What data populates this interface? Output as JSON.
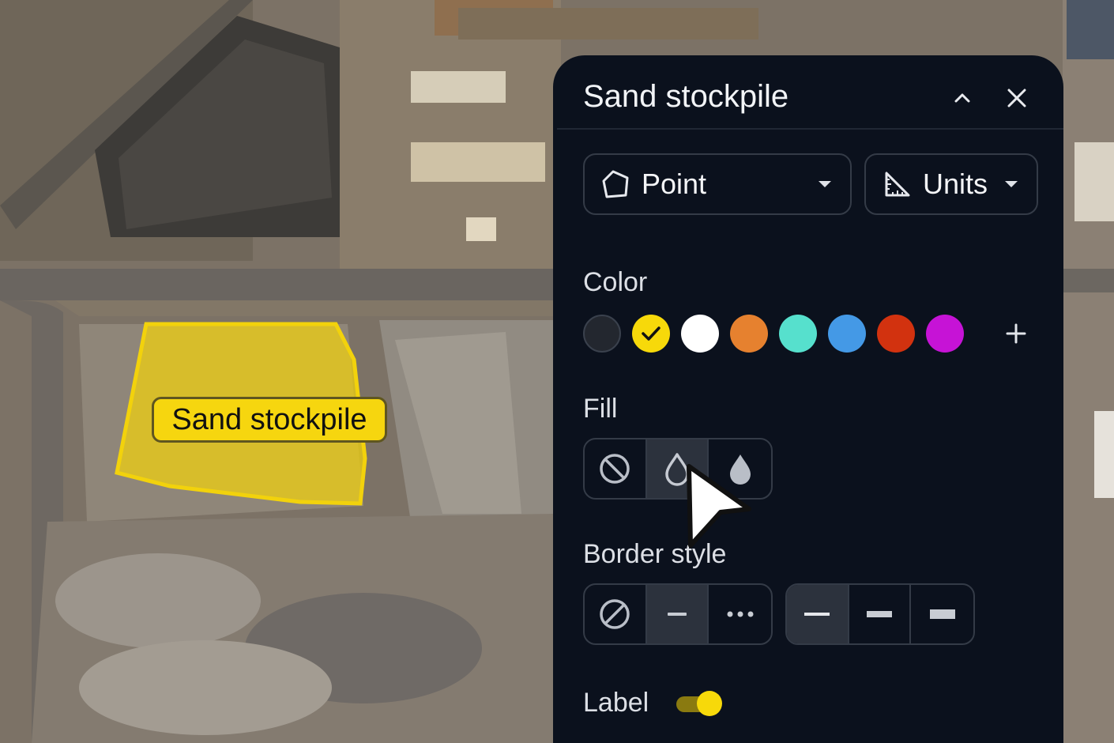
{
  "map": {
    "shape_label": "Sand stockpile",
    "shape_color": "#f2d20c"
  },
  "panel": {
    "title": "Sand stockpile",
    "collapse_icon": "chevron-up-icon",
    "close_icon": "close-icon",
    "type_dropdown": {
      "icon": "polygon-icon",
      "value": "Point"
    },
    "units_dropdown": {
      "icon": "ruler-triangle-icon",
      "value": "Units"
    },
    "color_label": "Color",
    "colors": [
      {
        "name": "black",
        "hex": "#23272f",
        "selected": false
      },
      {
        "name": "yellow",
        "hex": "#f7d90a",
        "selected": true
      },
      {
        "name": "white",
        "hex": "#ffffff",
        "selected": false
      },
      {
        "name": "orange",
        "hex": "#e6812f",
        "selected": false
      },
      {
        "name": "teal",
        "hex": "#56e0cd",
        "selected": false
      },
      {
        "name": "blue",
        "hex": "#4499e6",
        "selected": false
      },
      {
        "name": "red",
        "hex": "#d2320f",
        "selected": false
      },
      {
        "name": "purple",
        "hex": "#c613d6",
        "selected": false
      }
    ],
    "add_color_icon": "plus-icon",
    "fill_label": "Fill",
    "fill_options": [
      "none",
      "outline",
      "solid"
    ],
    "fill_selected": "outline",
    "border_label": "Border style",
    "border_style_options": [
      "none",
      "solid",
      "dotted"
    ],
    "border_style_selected": "solid",
    "border_width_options": [
      "thin",
      "medium",
      "thick"
    ],
    "border_width_selected": "thin",
    "label_label": "Label",
    "label_enabled": true
  }
}
